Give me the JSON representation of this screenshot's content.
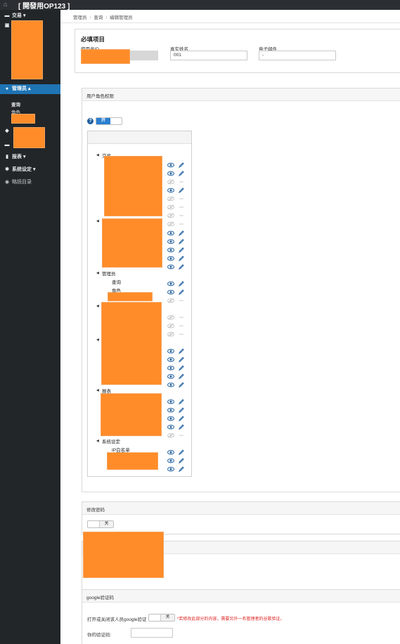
{
  "topbar": {
    "home_icon": "home-icon",
    "title": "[ 開發用OP123 ]"
  },
  "sidebar": {
    "items": [
      {
        "label": "交易",
        "icon": "card-icon"
      },
      {
        "label": "",
        "icon": "laptop-icon"
      },
      {
        "label": "管理员",
        "icon": "user-icon"
      },
      {
        "label": "",
        "icon": "tags-icon"
      },
      {
        "label": "",
        "icon": "card-icon"
      },
      {
        "label": "报表",
        "icon": "chart-icon"
      },
      {
        "label": "系统设定",
        "icon": "gear-icon"
      },
      {
        "label": "略読目录",
        "icon": "circle-icon"
      }
    ],
    "sub_query": "查询",
    "sub_role": "角色"
  },
  "breadcrumb": [
    "管理员",
    "查询",
    "编辑管理员"
  ],
  "required": {
    "title": "必填项目",
    "user_id_label": "使用者ID",
    "realname_label": "真实姓名",
    "realname_value": "001",
    "email_label": "电子邮件",
    "email_value": "-"
  },
  "permissions": {
    "title": "用户角色权限",
    "toggle_on": "开",
    "tree": {
      "trade": "交易",
      "admin": "管理员",
      "admin_query": "查询",
      "admin_role": "角色",
      "report": "报表",
      "system": "系统设定",
      "ip_whitelist": "IP白名单"
    }
  },
  "password": {
    "title": "修改密码",
    "toggle_off": "关"
  },
  "google": {
    "title": "google验证码",
    "toggle_label": "打开或关闭该人员google验证",
    "toggle_off": "关",
    "note": "*若修改此部分的内容，需要另外一名管理者的谷歌验证。",
    "code_label": "你的验证码:"
  },
  "colors": {
    "accent": "#1f74b4",
    "redact": "#ff8c28",
    "sidebar": "#222629"
  }
}
